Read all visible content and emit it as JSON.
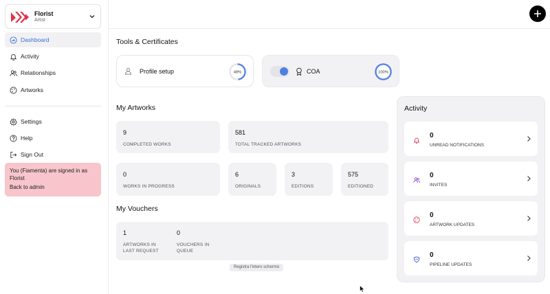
{
  "profile": {
    "name": "Florist",
    "role": "Artist"
  },
  "nav": {
    "main": [
      {
        "label": "Dashboard",
        "icon": "dashboard-icon",
        "active": true
      },
      {
        "label": "Activity",
        "icon": "bell-icon"
      },
      {
        "label": "Relationships",
        "icon": "users-icon"
      },
      {
        "label": "Artworks",
        "icon": "palette-icon"
      }
    ],
    "secondary": [
      {
        "label": "Settings",
        "icon": "gear-icon"
      },
      {
        "label": "Help",
        "icon": "help-icon"
      },
      {
        "label": "Sign Out",
        "icon": "sign-out-icon"
      }
    ]
  },
  "admin_notice": {
    "text": "You (Fiamenta) are signed in as Florist",
    "link": "Back to admin"
  },
  "tools": {
    "title": "Tools & Certificates",
    "profile_setup": {
      "label": "Profile setup",
      "progress_text": "48%",
      "progress": 0.48
    },
    "coa": {
      "label": "COA",
      "progress_text": "100%",
      "progress": 1.0
    }
  },
  "artworks": {
    "title": "My Artworks",
    "completed": {
      "value": "9",
      "label": "Completed works"
    },
    "tracked": {
      "value": "581",
      "label": "Total tracked artworks"
    },
    "in_progress": {
      "value": "0",
      "label": "Works in progress"
    },
    "originals": {
      "value": "6",
      "label": "Originals"
    },
    "editions": {
      "value": "3",
      "label": "Editions"
    },
    "editioned": {
      "value": "575",
      "label": "Editioned"
    }
  },
  "vouchers": {
    "title": "My Vouchers",
    "last_request": {
      "value": "1",
      "label_line1": "Artworks in",
      "label_line2": "last request"
    },
    "queue": {
      "value": "0",
      "label_line1": "Vouchers in",
      "label_line2": "queue"
    }
  },
  "activity": {
    "title": "Activity",
    "items": [
      {
        "value": "0",
        "label": "Unread notifications",
        "icon": "bell-icon"
      },
      {
        "value": "0",
        "label": "Invites",
        "icon": "users-icon"
      },
      {
        "value": "0",
        "label": "Artwork updates",
        "icon": "palette-icon"
      },
      {
        "value": "0",
        "label": "Pipeline updates",
        "icon": "shield-icon"
      }
    ]
  },
  "screen_share_chip": "Registra l'intero schermo",
  "colors": {
    "accent": "#3d6fd6",
    "admin_bg": "#f7c5cb",
    "card_bg": "#f2f2f4",
    "ring": "#5b86e0"
  }
}
